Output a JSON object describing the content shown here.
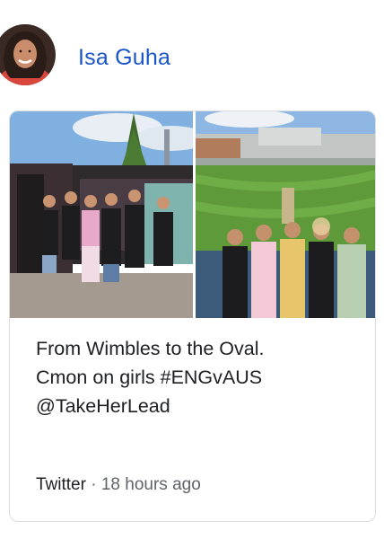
{
  "post": {
    "author": "Isa Guha",
    "text_lines": [
      "From Wimbles to the Oval.",
      "Cmon on girls #ENGvAUS",
      "@TakeHerLead"
    ],
    "source": "Twitter",
    "separator": "·",
    "timestamp": "18 hours ago"
  },
  "images": {
    "left": "group-photo-outdoor-event",
    "right": "group-photo-cricket-stadium"
  },
  "colors": {
    "author_link": "#1a55c8",
    "card_border": "#dadce0",
    "meta_gray": "#5f6368"
  }
}
